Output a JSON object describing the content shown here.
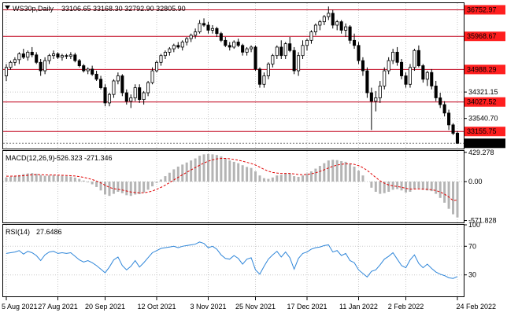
{
  "header": {
    "symbol": "WS30p,Daily",
    "ohlc": "33106.65 33168.30 32792.90 32805.90"
  },
  "colors": {
    "bull": "#000000",
    "bear": "#000000",
    "bull_fill": "#ffffff",
    "bear_fill": "#000000",
    "level_line": "#c0001a",
    "level_label_bg": "#ff1f1f",
    "level_label_text": "#ffffff",
    "current_label_bg": "#000000",
    "current_label_text": "#ffffff",
    "macd_hist": "#b4b4b4",
    "macd_signal": "#e00000",
    "rsi_line": "#2f86d9",
    "grid": "#c8c8c8",
    "frame": "#000000"
  },
  "chart_data": {
    "type": "candlestick",
    "price_axis": {
      "ylim": [
        32650,
        36950
      ],
      "labels": [
        "33540.70",
        "34321.15"
      ]
    },
    "levels": [
      {
        "value": 36752.97,
        "label": "36752.97"
      },
      {
        "value": 35968.67,
        "label": "35968.67"
      },
      {
        "value": 34988.29,
        "label": "34988.29"
      },
      {
        "value": 34027.52,
        "label": "34027.52"
      },
      {
        "value": 33155.75,
        "label": "33155.75"
      }
    ],
    "current_price": {
      "value": 32805.9,
      "label": "32805.90"
    },
    "dates": [
      "5 Aug 2021",
      "27 Aug 2021",
      "20 Sep 2021",
      "12 Oct 2021",
      "3 Nov 2021",
      "25 Nov 2021",
      "17 Dec 2021",
      "11 Jan 2022",
      "2 Feb 2022",
      "24 Feb 2022"
    ],
    "ohlc": [
      [
        34800,
        35150,
        34650,
        35050
      ],
      [
        35050,
        35250,
        34980,
        35200
      ],
      [
        35200,
        35350,
        35100,
        35280
      ],
      [
        35280,
        35500,
        35150,
        35450
      ],
      [
        35450,
        35600,
        35300,
        35350
      ],
      [
        35350,
        35550,
        35250,
        35500
      ],
      [
        35500,
        35650,
        35350,
        35420
      ],
      [
        35420,
        35500,
        35150,
        35200
      ],
      [
        35200,
        35300,
        34800,
        34950
      ],
      [
        34950,
        35350,
        34850,
        35250
      ],
      [
        35250,
        35450,
        35150,
        35400
      ],
      [
        35400,
        35550,
        35300,
        35450
      ],
      [
        35450,
        35500,
        35300,
        35350
      ],
      [
        35350,
        35450,
        35250,
        35400
      ],
      [
        35400,
        35450,
        35300,
        35380
      ],
      [
        35380,
        35500,
        35300,
        35420
      ],
      [
        35420,
        35480,
        35200,
        35250
      ],
      [
        35250,
        35300,
        35050,
        35100
      ],
      [
        35100,
        35150,
        34900,
        34950
      ],
      [
        34950,
        35050,
        34850,
        35000
      ],
      [
        35000,
        35100,
        34800,
        34850
      ],
      [
        34850,
        34950,
        34650,
        34700
      ],
      [
        34700,
        34800,
        34400,
        34450
      ],
      [
        34450,
        34550,
        33900,
        34000
      ],
      [
        34000,
        34300,
        33900,
        34250
      ],
      [
        34250,
        34700,
        34150,
        34650
      ],
      [
        34650,
        34900,
        34550,
        34800
      ],
      [
        34800,
        34850,
        34200,
        34300
      ],
      [
        34300,
        34400,
        33950,
        34050
      ],
      [
        34050,
        34250,
        33850,
        34150
      ],
      [
        34150,
        34550,
        34050,
        34450
      ],
      [
        34450,
        34550,
        34000,
        34100
      ],
      [
        34100,
        34350,
        33950,
        34300
      ],
      [
        34300,
        34650,
        34200,
        34600
      ],
      [
        34600,
        35050,
        34550,
        34950
      ],
      [
        34950,
        35250,
        34900,
        35200
      ],
      [
        35200,
        35450,
        35100,
        35400
      ],
      [
        35400,
        35550,
        35300,
        35500
      ],
      [
        35500,
        35650,
        35400,
        35600
      ],
      [
        35600,
        35750,
        35500,
        35700
      ],
      [
        35700,
        35800,
        35600,
        35650
      ],
      [
        35650,
        35850,
        35550,
        35800
      ],
      [
        35800,
        35950,
        35700,
        35900
      ],
      [
        35900,
        36050,
        35800,
        36000
      ],
      [
        36000,
        36200,
        35900,
        36100
      ],
      [
        36100,
        36450,
        36050,
        36350
      ],
      [
        36350,
        36500,
        36250,
        36300
      ],
      [
        36300,
        36400,
        36050,
        36150
      ],
      [
        36150,
        36300,
        36050,
        36200
      ],
      [
        36200,
        36250,
        35950,
        36050
      ],
      [
        36050,
        36100,
        35800,
        35850
      ],
      [
        35850,
        35950,
        35650,
        35700
      ],
      [
        35700,
        35800,
        35550,
        35650
      ],
      [
        35650,
        35850,
        35600,
        35800
      ],
      [
        35800,
        35900,
        35650,
        35700
      ],
      [
        35700,
        35750,
        35400,
        35500
      ],
      [
        35500,
        35650,
        35400,
        35600
      ],
      [
        35600,
        35700,
        35500,
        35650
      ],
      [
        35650,
        35700,
        34950,
        35000
      ],
      [
        35000,
        35050,
        34450,
        34550
      ],
      [
        34550,
        34900,
        34450,
        34800
      ],
      [
        34800,
        35200,
        34700,
        35150
      ],
      [
        35150,
        35450,
        35050,
        35400
      ],
      [
        35400,
        35700,
        35300,
        35650
      ],
      [
        35650,
        35850,
        35300,
        35400
      ],
      [
        35400,
        35800,
        35300,
        35750
      ],
      [
        35750,
        35950,
        35500,
        35550
      ],
      [
        35550,
        35650,
        34850,
        34950
      ],
      [
        34950,
        35500,
        34800,
        35400
      ],
      [
        35400,
        35850,
        35300,
        35700
      ],
      [
        35700,
        35900,
        35550,
        35850
      ],
      [
        35850,
        36150,
        35750,
        36100
      ],
      [
        36100,
        36350,
        36000,
        36300
      ],
      [
        36300,
        36450,
        36150,
        36400
      ],
      [
        36400,
        36600,
        36300,
        36550
      ],
      [
        36550,
        36850,
        36450,
        36650
      ],
      [
        36650,
        36750,
        36200,
        36300
      ],
      [
        36300,
        36450,
        36150,
        36400
      ],
      [
        36400,
        36450,
        36050,
        36150
      ],
      [
        36150,
        36350,
        35950,
        36250
      ],
      [
        36250,
        36300,
        35750,
        35850
      ],
      [
        35850,
        36050,
        35600,
        35700
      ],
      [
        35700,
        35800,
        35150,
        35250
      ],
      [
        35250,
        35350,
        34800,
        34950
      ],
      [
        34950,
        35050,
        34150,
        34300
      ],
      [
        34300,
        34450,
        33200,
        34050
      ],
      [
        34050,
        34350,
        33750,
        34150
      ],
      [
        34150,
        34650,
        34000,
        34500
      ],
      [
        34500,
        35050,
        34400,
        34950
      ],
      [
        34950,
        35350,
        34850,
        35250
      ],
      [
        35250,
        35600,
        35150,
        35500
      ],
      [
        35500,
        35650,
        35100,
        35200
      ],
      [
        35200,
        35300,
        34700,
        34800
      ],
      [
        34800,
        34900,
        34450,
        34550
      ],
      [
        34550,
        35150,
        34450,
        35050
      ],
      [
        35050,
        35600,
        34950,
        35550
      ],
      [
        35550,
        35700,
        35050,
        35100
      ],
      [
        35100,
        35150,
        34600,
        34700
      ],
      [
        34700,
        34950,
        34500,
        34900
      ],
      [
        34900,
        35000,
        34400,
        34500
      ],
      [
        34500,
        34650,
        34050,
        34150
      ],
      [
        34150,
        34300,
        33850,
        33950
      ],
      [
        33950,
        34050,
        33600,
        33700
      ],
      [
        33700,
        33800,
        33200,
        33350
      ],
      [
        33350,
        33400,
        33050,
        33100
      ],
      [
        33106.65,
        33168.3,
        32792.9,
        32805.9
      ]
    ],
    "macd": {
      "label": "MACD(12,26,9)",
      "values_text": "-526.323 -271.346",
      "ylim": [
        -600,
        450
      ],
      "ticks": [
        "429.278",
        "0.00",
        "-571.828"
      ],
      "histogram": [
        60,
        70,
        80,
        95,
        110,
        120,
        125,
        115,
        95,
        85,
        90,
        95,
        90,
        85,
        80,
        75,
        60,
        40,
        15,
        -10,
        -40,
        -80,
        -130,
        -190,
        -210,
        -180,
        -150,
        -170,
        -200,
        -210,
        -190,
        -185,
        -160,
        -120,
        -70,
        -20,
        30,
        80,
        130,
        180,
        220,
        250,
        280,
        310,
        340,
        380,
        400,
        405,
        400,
        390,
        370,
        340,
        310,
        290,
        270,
        240,
        215,
        200,
        150,
        90,
        50,
        40,
        60,
        90,
        100,
        120,
        120,
        80,
        70,
        90,
        120,
        150,
        190,
        230,
        270,
        310,
        320,
        315,
        300,
        290,
        260,
        220,
        160,
        90,
        0,
        -90,
        -150,
        -180,
        -170,
        -150,
        -120,
        -110,
        -130,
        -160,
        -150,
        -110,
        -100,
        -120,
        -130,
        -140,
        -180,
        -240,
        -310,
        -400,
        -480,
        -526
      ],
      "signal": [
        80,
        80,
        81,
        83,
        87,
        93,
        99,
        103,
        101,
        98,
        96,
        96,
        95,
        93,
        90,
        87,
        82,
        73,
        62,
        48,
        30,
        8,
        -20,
        -54,
        -85,
        -104,
        -113,
        -124,
        -139,
        -153,
        -160,
        -165,
        -164,
        -155,
        -138,
        -114,
        -85,
        -52,
        -15,
        24,
        63,
        100,
        136,
        171,
        205,
        240,
        272,
        299,
        319,
        333,
        340,
        340,
        334,
        325,
        314,
        299,
        282,
        266,
        243,
        212,
        180,
        152,
        134,
        125,
        120,
        120,
        120,
        112,
        104,
        101,
        105,
        114,
        129,
        149,
        173,
        200,
        224,
        242,
        254,
        261,
        261,
        253,
        234,
        205,
        164,
        113,
        60,
        12,
        -24,
        -49,
        -63,
        -72,
        -84,
        -99,
        -109,
        -109,
        -107,
        -110,
        -114,
        -119,
        -131,
        -153,
        -184,
        -227,
        -278,
        -271
      ]
    },
    "rsi": {
      "label": "RSI(14)",
      "value_text": "27.6486",
      "ylim": [
        0,
        100
      ],
      "ticks": [
        "100",
        "70",
        "30",
        "0"
      ],
      "levels": [
        70,
        30
      ],
      "values": [
        60,
        61,
        62,
        64,
        59,
        63,
        61,
        57,
        50,
        58,
        62,
        63,
        60,
        61,
        60,
        61,
        56,
        51,
        48,
        50,
        47,
        43,
        38,
        33,
        41,
        51,
        55,
        43,
        37,
        42,
        50,
        41,
        47,
        54,
        61,
        64,
        67,
        68,
        69,
        70,
        68,
        70,
        71,
        72,
        73,
        76,
        74,
        68,
        70,
        66,
        58,
        53,
        52,
        57,
        53,
        45,
        52,
        54,
        37,
        31,
        42,
        52,
        58,
        63,
        55,
        62,
        54,
        38,
        53,
        60,
        62,
        66,
        68,
        69,
        71,
        72,
        62,
        64,
        57,
        60,
        50,
        47,
        37,
        32,
        27,
        35,
        37,
        44,
        52,
        56,
        61,
        52,
        43,
        40,
        51,
        58,
        46,
        40,
        45,
        39,
        34,
        31,
        29,
        26,
        25,
        27.6486
      ]
    }
  }
}
